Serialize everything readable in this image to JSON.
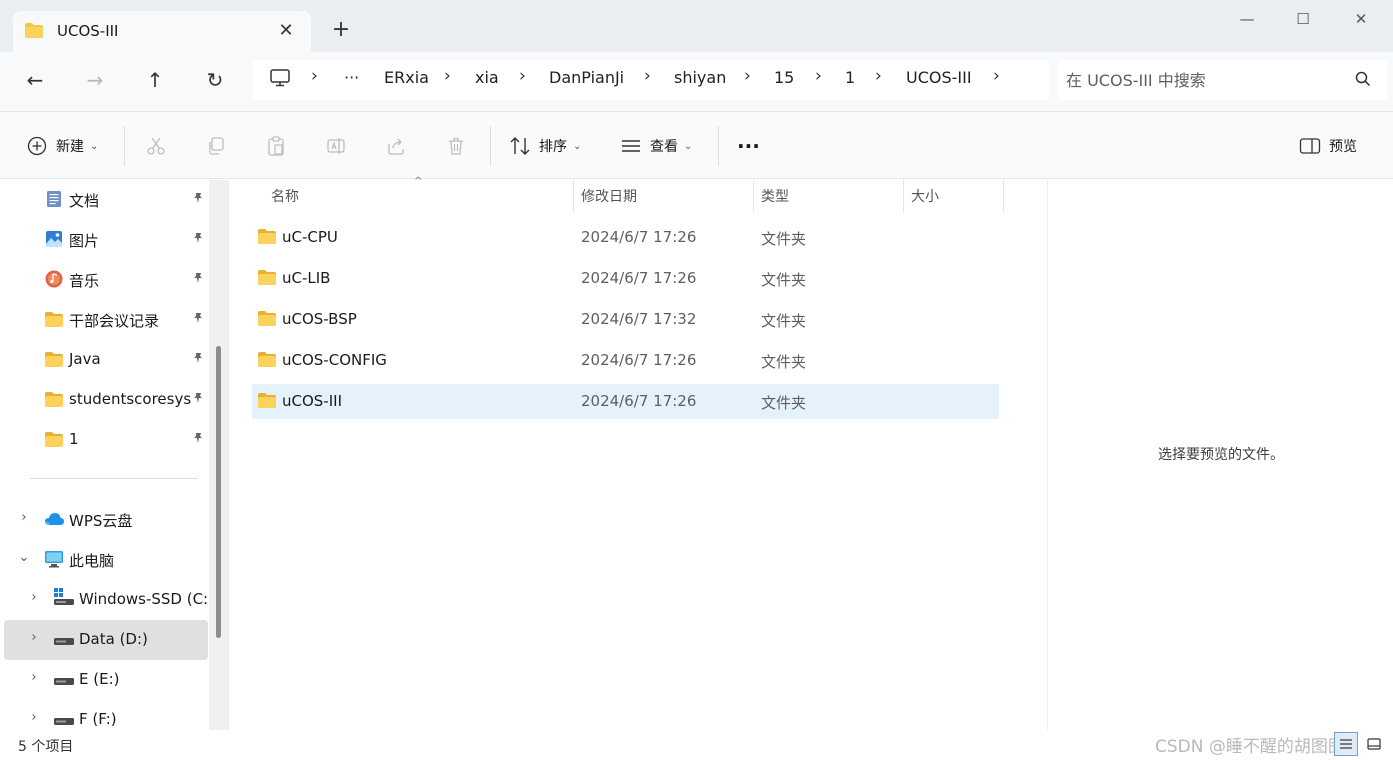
{
  "window": {
    "tab_title": "UCOS-III",
    "new_tab": "+",
    "minimize": "—",
    "maximize": "☐",
    "close": "✕"
  },
  "nav": {
    "back": "←",
    "forward": "→",
    "up": "↑",
    "refresh": "↻"
  },
  "breadcrumb": {
    "overflow": "···",
    "items": [
      "ERxia",
      "xia",
      "DanPianJi",
      "shiyan",
      "15",
      "1",
      "UCOS-III"
    ],
    "separator": "›"
  },
  "search": {
    "placeholder": "在 UCOS-III 中搜索"
  },
  "toolbar": {
    "new_label": "新建",
    "sort_label": "排序",
    "view_label": "查看",
    "more_label": "···",
    "preview_label": "预览",
    "caret": "⌄"
  },
  "sidebar": {
    "pin": "📌",
    "quick_access": [
      {
        "label": "文档",
        "icon": "documents-icon"
      },
      {
        "label": "图片",
        "icon": "pictures-icon"
      },
      {
        "label": "音乐",
        "icon": "music-icon"
      },
      {
        "label": "干部会议记录",
        "icon": "folder-icon"
      },
      {
        "label": "Java",
        "icon": "folder-icon"
      },
      {
        "label": "studentscoresys",
        "icon": "folder-icon"
      },
      {
        "label": "1",
        "icon": "folder-icon"
      }
    ],
    "locations": [
      {
        "label": "WPS云盘",
        "icon": "cloud-icon",
        "chevron": "›"
      },
      {
        "label": "此电脑",
        "icon": "pc-icon",
        "chevron": "⌄"
      },
      {
        "label": "Windows-SSD (C:)",
        "icon": "windows-drive-icon",
        "chevron": "›"
      },
      {
        "label": "Data (D:)",
        "icon": "drive-icon",
        "chevron": "›"
      },
      {
        "label": "E (E:)",
        "icon": "drive-icon",
        "chevron": "›"
      },
      {
        "label": "F (F:)",
        "icon": "drive-icon",
        "chevron": "›"
      }
    ]
  },
  "columns": {
    "name": "名称",
    "modified": "修改日期",
    "type": "类型",
    "size": "大小",
    "sort_indicator": "^"
  },
  "files": [
    {
      "name": "uC-CPU",
      "modified": "2024/6/7 17:26",
      "type": "文件夹"
    },
    {
      "name": "uC-LIB",
      "modified": "2024/6/7 17:26",
      "type": "文件夹"
    },
    {
      "name": "uCOS-BSP",
      "modified": "2024/6/7 17:32",
      "type": "文件夹"
    },
    {
      "name": "uCOS-CONFIG",
      "modified": "2024/6/7 17:26",
      "type": "文件夹"
    },
    {
      "name": "uCOS-III",
      "modified": "2024/6/7 17:26",
      "type": "文件夹"
    }
  ],
  "preview": {
    "message": "选择要预览的文件。"
  },
  "status": {
    "item_count": "5 个项目",
    "watermark": "CSDN @睡不醒的胡图图"
  },
  "colors": {
    "folder": "#f8c646",
    "folder_dark": "#e3a91f",
    "selection": "#e5f1fb",
    "accent": "#0067c0"
  }
}
